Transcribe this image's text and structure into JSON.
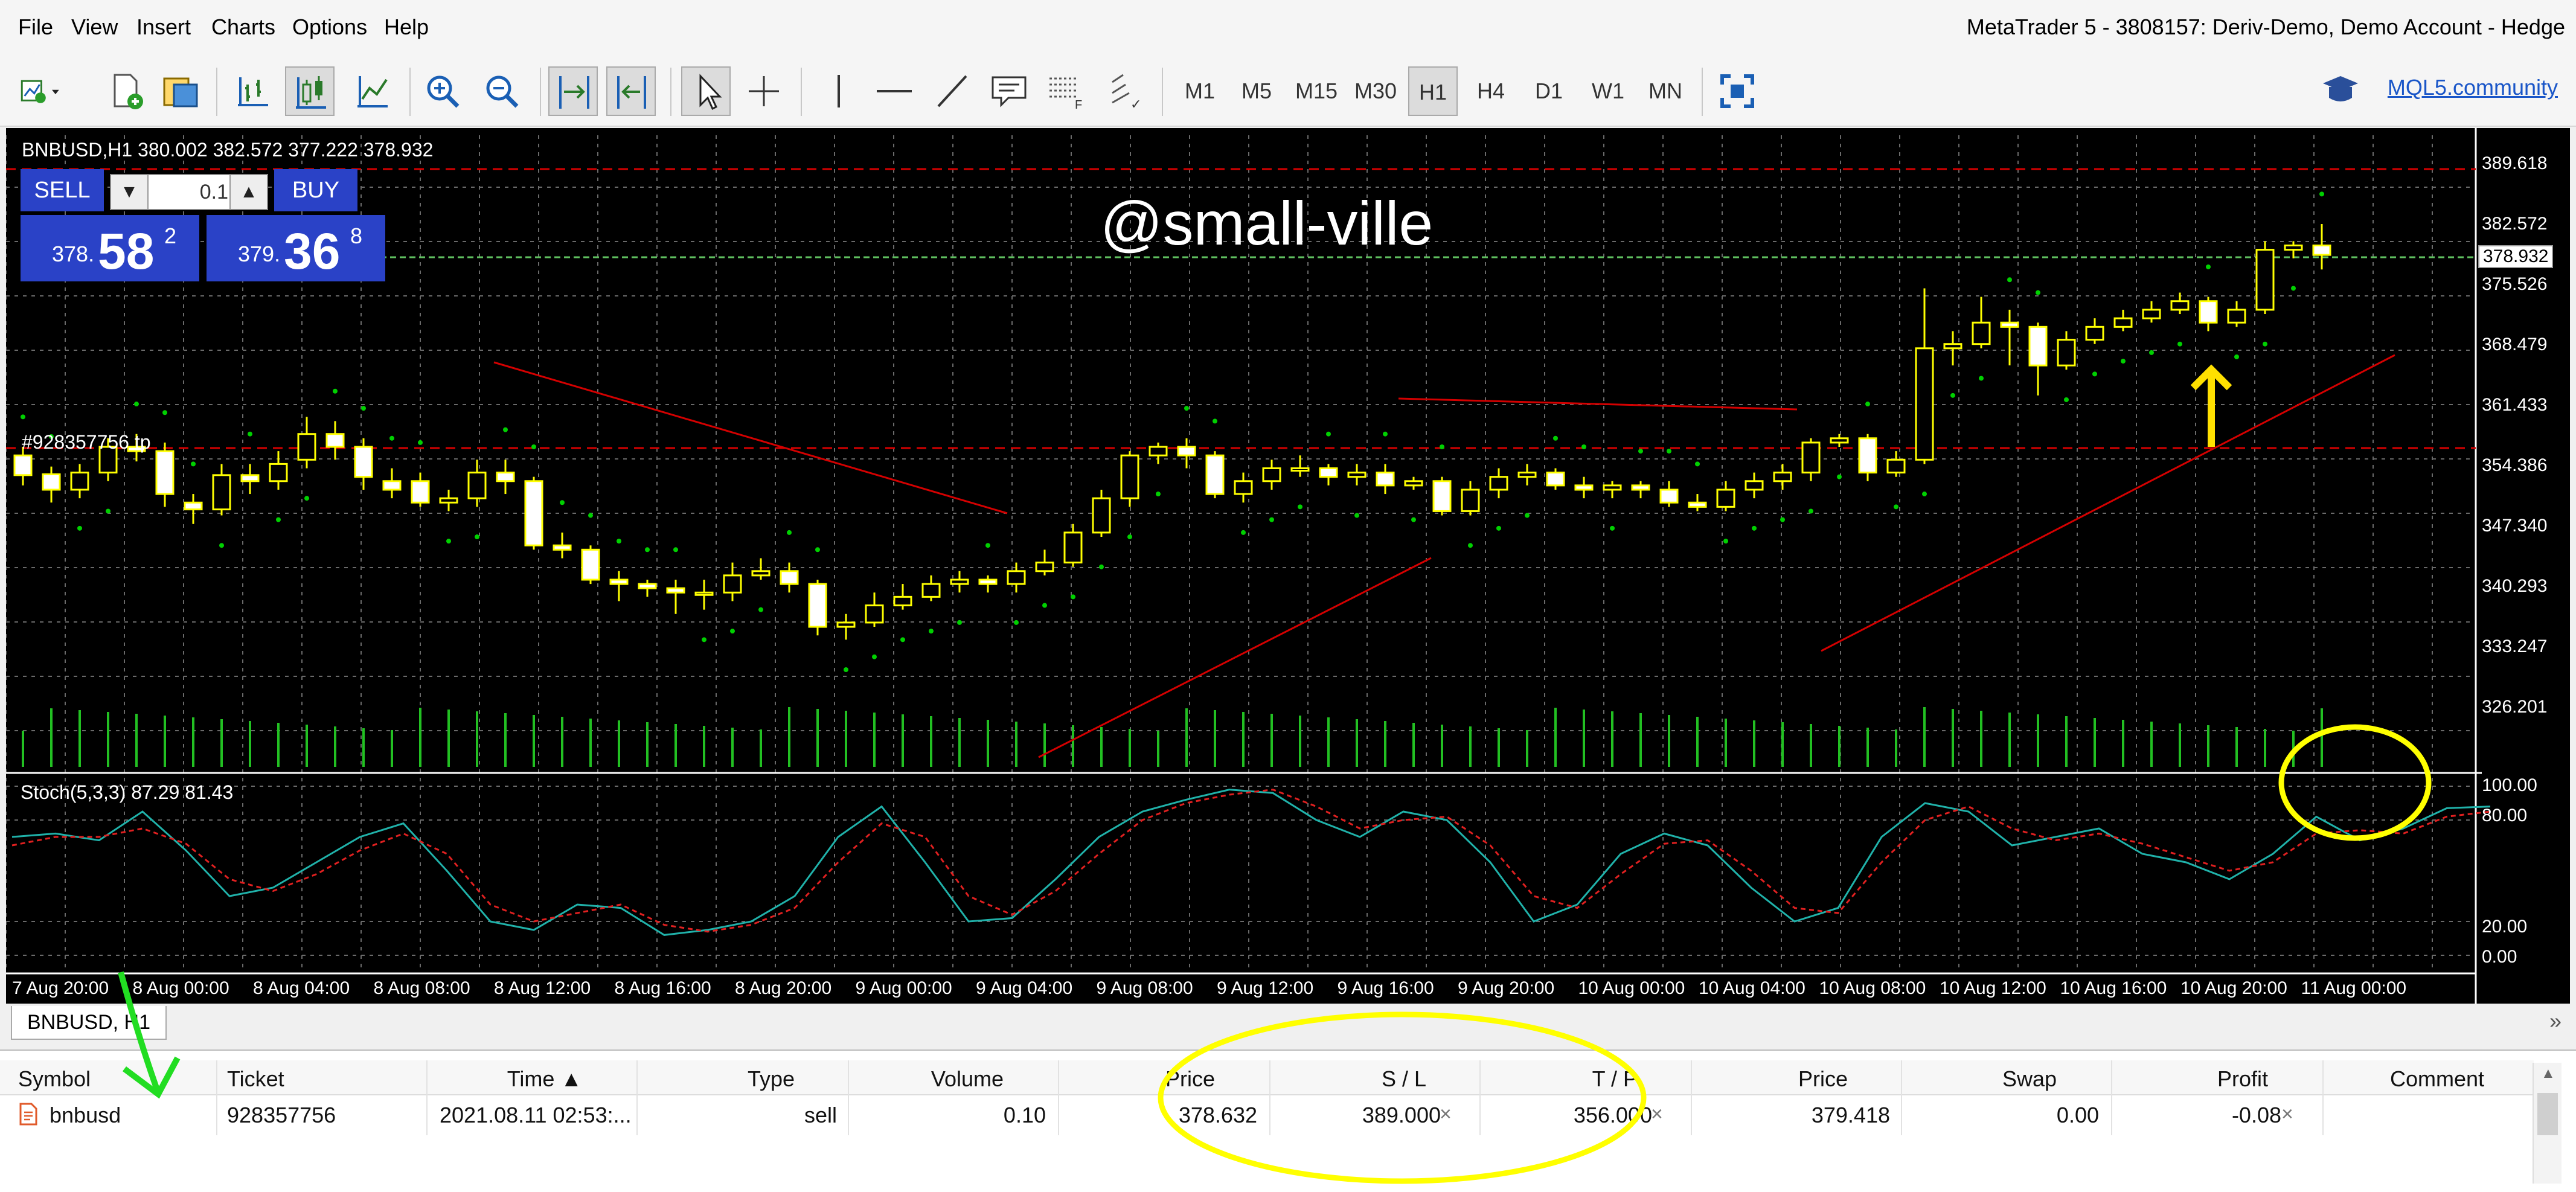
{
  "menu": {
    "file": "File",
    "view": "View",
    "insert": "Insert",
    "charts": "Charts",
    "options": "Options",
    "help": "Help",
    "title": "MetaTrader 5 - 3808157: Deriv-Demo, Demo Account - Hedge"
  },
  "toolbar": {
    "timeframes": [
      "M1",
      "M5",
      "M15",
      "M30",
      "H1",
      "H4",
      "D1",
      "W1",
      "MN"
    ],
    "active_timeframe": "H1",
    "mql5_link": "MQL5.community"
  },
  "chart": {
    "info_line": "BNBUSD,H1  380.002 382.572 377.222 378.932",
    "one_click": {
      "sell_label": "SELL",
      "buy_label": "BUY",
      "lot": "0.1",
      "sell_small": "378.",
      "sell_big": "58",
      "sell_sup": "2",
      "buy_small": "379.",
      "buy_big": "36",
      "buy_sup": "8"
    },
    "watermark": "@small-ville",
    "tp_label": "#928357756 tp",
    "stoch_label": "Stoch(5,3,3) 87.29 81.43",
    "price_axis": [
      "389.618",
      "382.572",
      "378.932",
      "375.526",
      "368.479",
      "361.433",
      "354.386",
      "347.340",
      "340.293",
      "333.247",
      "326.201"
    ],
    "current_price": "378.932",
    "stoch_axis": [
      "100.00",
      "80.00",
      "20.00",
      "0.00"
    ],
    "time_axis": [
      "7 Aug 20:00",
      "8 Aug 00:00",
      "8 Aug 04:00",
      "8 Aug 08:00",
      "8 Aug 12:00",
      "8 Aug 16:00",
      "8 Aug 20:00",
      "9 Aug 00:00",
      "9 Aug 04:00",
      "9 Aug 08:00",
      "9 Aug 12:00",
      "9 Aug 16:00",
      "9 Aug 20:00",
      "10 Aug 00:00",
      "10 Aug 04:00",
      "10 Aug 08:00",
      "10 Aug 12:00",
      "10 Aug 16:00",
      "10 Aug 20:00",
      "11 Aug 00:00"
    ],
    "colors": {
      "bull": "#ffffff",
      "bear": "#ffff00",
      "grid": "#6a6a6a",
      "sar": "#00d000",
      "trend": "#d40000",
      "stoch_main": "#20b2aa",
      "stoch_signal": "#e02020"
    }
  },
  "tabs": {
    "chart_tab": "BNBUSD, H1",
    "more": "»"
  },
  "trade_table": {
    "headers": {
      "symbol": "Symbol",
      "ticket": "Ticket",
      "time": "Time ▲",
      "type": "Type",
      "volume": "Volume",
      "price": "Price",
      "sl": "S / L",
      "tp": "T / P",
      "cur_price": "Price",
      "swap": "Swap",
      "profit": "Profit",
      "comment": "Comment"
    },
    "row": {
      "symbol": "bnbusd",
      "ticket": "928357756",
      "time": "2021.08.11 02:53:...",
      "type": "sell",
      "volume": "0.10",
      "price": "378.632",
      "sl": "389.000",
      "tp": "356.000",
      "cur_price": "379.418",
      "swap": "0.00",
      "profit": "-0.08",
      "comment": ""
    }
  }
}
